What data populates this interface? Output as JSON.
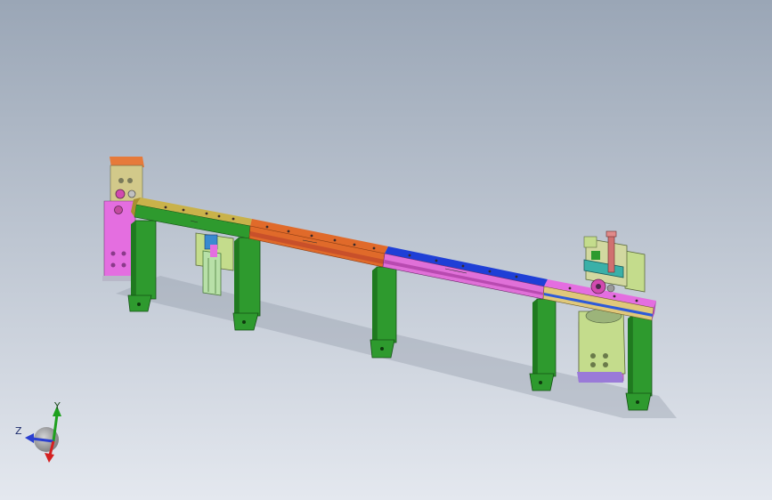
{
  "viewport": {
    "background_top": "#9aa6b6",
    "background_bottom": "#e4e8ef"
  },
  "triad": {
    "x_label": "",
    "y_label": "Y",
    "z_label": "Z",
    "x_color": "#d42020",
    "y_color": "#1ea01e",
    "z_color": "#2a3fd0"
  },
  "model": {
    "frame_color": "#2e9a2e",
    "segment_colors": [
      "#c9b24a",
      "#e06a2a",
      "#1f3fd6",
      "#e070d8"
    ],
    "end_block_color": "#e46ee0",
    "bracket_color": "#c4dc8c"
  }
}
